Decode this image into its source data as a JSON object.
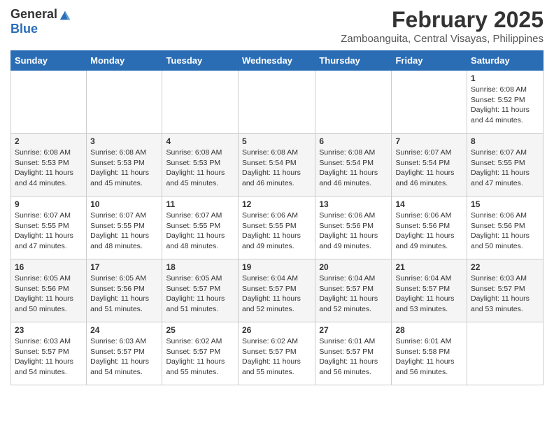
{
  "logo": {
    "general": "General",
    "blue": "Blue"
  },
  "header": {
    "title": "February 2025",
    "subtitle": "Zamboanguita, Central Visayas, Philippines"
  },
  "weekdays": [
    "Sunday",
    "Monday",
    "Tuesday",
    "Wednesday",
    "Thursday",
    "Friday",
    "Saturday"
  ],
  "weeks": [
    [
      {
        "day": "",
        "info": ""
      },
      {
        "day": "",
        "info": ""
      },
      {
        "day": "",
        "info": ""
      },
      {
        "day": "",
        "info": ""
      },
      {
        "day": "",
        "info": ""
      },
      {
        "day": "",
        "info": ""
      },
      {
        "day": "1",
        "info": "Sunrise: 6:08 AM\nSunset: 5:52 PM\nDaylight: 11 hours\nand 44 minutes."
      }
    ],
    [
      {
        "day": "2",
        "info": "Sunrise: 6:08 AM\nSunset: 5:53 PM\nDaylight: 11 hours\nand 44 minutes."
      },
      {
        "day": "3",
        "info": "Sunrise: 6:08 AM\nSunset: 5:53 PM\nDaylight: 11 hours\nand 45 minutes."
      },
      {
        "day": "4",
        "info": "Sunrise: 6:08 AM\nSunset: 5:53 PM\nDaylight: 11 hours\nand 45 minutes."
      },
      {
        "day": "5",
        "info": "Sunrise: 6:08 AM\nSunset: 5:54 PM\nDaylight: 11 hours\nand 46 minutes."
      },
      {
        "day": "6",
        "info": "Sunrise: 6:08 AM\nSunset: 5:54 PM\nDaylight: 11 hours\nand 46 minutes."
      },
      {
        "day": "7",
        "info": "Sunrise: 6:07 AM\nSunset: 5:54 PM\nDaylight: 11 hours\nand 46 minutes."
      },
      {
        "day": "8",
        "info": "Sunrise: 6:07 AM\nSunset: 5:55 PM\nDaylight: 11 hours\nand 47 minutes."
      }
    ],
    [
      {
        "day": "9",
        "info": "Sunrise: 6:07 AM\nSunset: 5:55 PM\nDaylight: 11 hours\nand 47 minutes."
      },
      {
        "day": "10",
        "info": "Sunrise: 6:07 AM\nSunset: 5:55 PM\nDaylight: 11 hours\nand 48 minutes."
      },
      {
        "day": "11",
        "info": "Sunrise: 6:07 AM\nSunset: 5:55 PM\nDaylight: 11 hours\nand 48 minutes."
      },
      {
        "day": "12",
        "info": "Sunrise: 6:06 AM\nSunset: 5:55 PM\nDaylight: 11 hours\nand 49 minutes."
      },
      {
        "day": "13",
        "info": "Sunrise: 6:06 AM\nSunset: 5:56 PM\nDaylight: 11 hours\nand 49 minutes."
      },
      {
        "day": "14",
        "info": "Sunrise: 6:06 AM\nSunset: 5:56 PM\nDaylight: 11 hours\nand 49 minutes."
      },
      {
        "day": "15",
        "info": "Sunrise: 6:06 AM\nSunset: 5:56 PM\nDaylight: 11 hours\nand 50 minutes."
      }
    ],
    [
      {
        "day": "16",
        "info": "Sunrise: 6:05 AM\nSunset: 5:56 PM\nDaylight: 11 hours\nand 50 minutes."
      },
      {
        "day": "17",
        "info": "Sunrise: 6:05 AM\nSunset: 5:56 PM\nDaylight: 11 hours\nand 51 minutes."
      },
      {
        "day": "18",
        "info": "Sunrise: 6:05 AM\nSunset: 5:57 PM\nDaylight: 11 hours\nand 51 minutes."
      },
      {
        "day": "19",
        "info": "Sunrise: 6:04 AM\nSunset: 5:57 PM\nDaylight: 11 hours\nand 52 minutes."
      },
      {
        "day": "20",
        "info": "Sunrise: 6:04 AM\nSunset: 5:57 PM\nDaylight: 11 hours\nand 52 minutes."
      },
      {
        "day": "21",
        "info": "Sunrise: 6:04 AM\nSunset: 5:57 PM\nDaylight: 11 hours\nand 53 minutes."
      },
      {
        "day": "22",
        "info": "Sunrise: 6:03 AM\nSunset: 5:57 PM\nDaylight: 11 hours\nand 53 minutes."
      }
    ],
    [
      {
        "day": "23",
        "info": "Sunrise: 6:03 AM\nSunset: 5:57 PM\nDaylight: 11 hours\nand 54 minutes."
      },
      {
        "day": "24",
        "info": "Sunrise: 6:03 AM\nSunset: 5:57 PM\nDaylight: 11 hours\nand 54 minutes."
      },
      {
        "day": "25",
        "info": "Sunrise: 6:02 AM\nSunset: 5:57 PM\nDaylight: 11 hours\nand 55 minutes."
      },
      {
        "day": "26",
        "info": "Sunrise: 6:02 AM\nSunset: 5:57 PM\nDaylight: 11 hours\nand 55 minutes."
      },
      {
        "day": "27",
        "info": "Sunrise: 6:01 AM\nSunset: 5:57 PM\nDaylight: 11 hours\nand 56 minutes."
      },
      {
        "day": "28",
        "info": "Sunrise: 6:01 AM\nSunset: 5:58 PM\nDaylight: 11 hours\nand 56 minutes."
      },
      {
        "day": "",
        "info": ""
      }
    ]
  ]
}
